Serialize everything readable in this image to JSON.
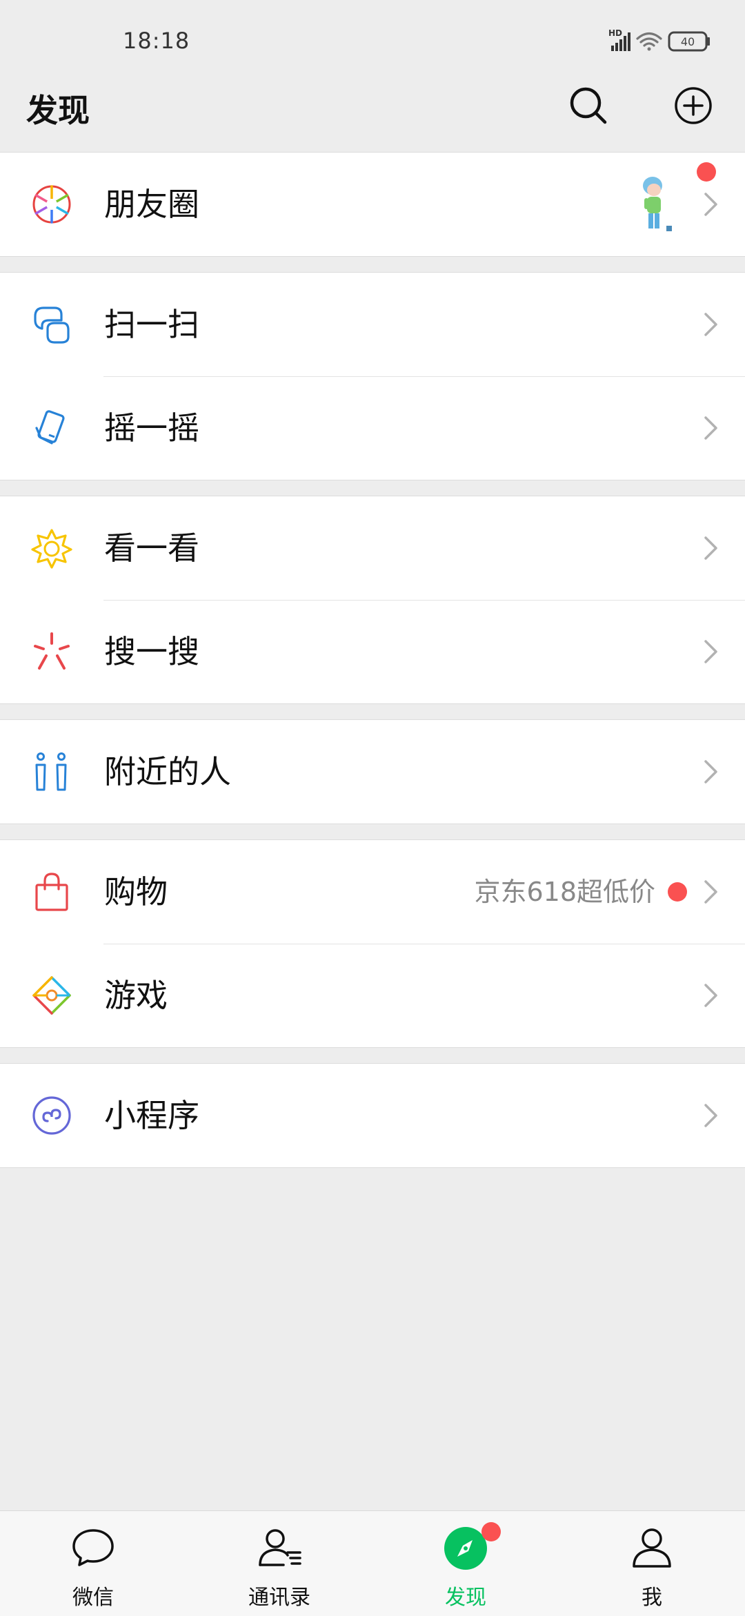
{
  "status_bar": {
    "time": "18:18",
    "network_label": "HD",
    "battery_level": "40"
  },
  "header": {
    "title": "发现"
  },
  "groups": [
    [
      {
        "label": "朋友圈",
        "icon": "moments-icon",
        "badge": true,
        "thumbnail": true
      }
    ],
    [
      {
        "label": "扫一扫",
        "icon": "scan-icon"
      },
      {
        "label": "摇一摇",
        "icon": "shake-icon"
      }
    ],
    [
      {
        "label": "看一看",
        "icon": "top-stories-icon"
      },
      {
        "label": "搜一搜",
        "icon": "search-sparkle-icon"
      }
    ],
    [
      {
        "label": "附近的人",
        "icon": "people-nearby-icon"
      }
    ],
    [
      {
        "label": "购物",
        "icon": "shopping-bag-icon",
        "hint": "京东618超低价",
        "badge": true
      },
      {
        "label": "游戏",
        "icon": "games-icon"
      }
    ],
    [
      {
        "label": "小程序",
        "icon": "mini-programs-icon"
      }
    ]
  ],
  "tabs": [
    {
      "label": "微信",
      "icon": "chat-icon",
      "active": false
    },
    {
      "label": "通讯录",
      "icon": "contacts-icon",
      "active": false
    },
    {
      "label": "发现",
      "icon": "discover-compass-icon",
      "active": true,
      "badge": true
    },
    {
      "label": "我",
      "icon": "me-icon",
      "active": false
    }
  ],
  "colors": {
    "background": "#ededed",
    "accent_green": "#07c160",
    "badge_red": "#fa5151"
  }
}
